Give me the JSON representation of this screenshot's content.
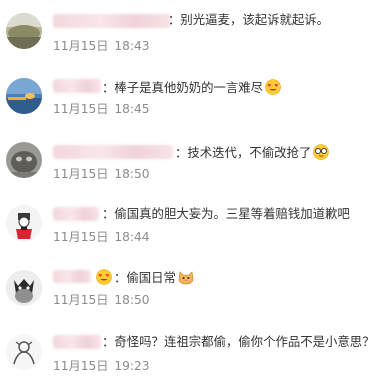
{
  "comments": [
    {
      "text": "：别光逼麦，该起诉就起诉。",
      "date": "11月15日",
      "time": "18:43",
      "avatar": "landscape-photo-avatar",
      "emoji": ""
    },
    {
      "text": "：棒子是真他奶奶的一言难尽",
      "date": "11月15日",
      "time": "18:45",
      "avatar": "sunset-sea-avatar",
      "emoji": "heart-eyes-emoji"
    },
    {
      "text": "：技术迭代，不偷改抢了",
      "date": "11月15日",
      "time": "18:50",
      "avatar": "gray-animal-avatar",
      "emoji": "glasses-emoji"
    },
    {
      "text": "：偷国真的胆大妄为。三星等着赔钱加道歉吧",
      "date": "11月15日",
      "time": "18:44",
      "avatar": "cartoon-figure-avatar",
      "emoji": ""
    },
    {
      "text": "：偷国日常",
      "date": "11月15日",
      "time": "18:50",
      "avatar": "cartoon-character-avatar",
      "emoji": "cat-emoji"
    },
    {
      "text": "：奇怪吗？连祖宗都偷，偷你个作品不是小意思？",
      "date": "11月15日",
      "time": "19:23",
      "avatar": "sketch-figure-avatar",
      "emoji": ""
    }
  ],
  "colors": {
    "text": "#333333",
    "meta": "#8c8c8c",
    "name_blur": "#f3d7dc"
  }
}
